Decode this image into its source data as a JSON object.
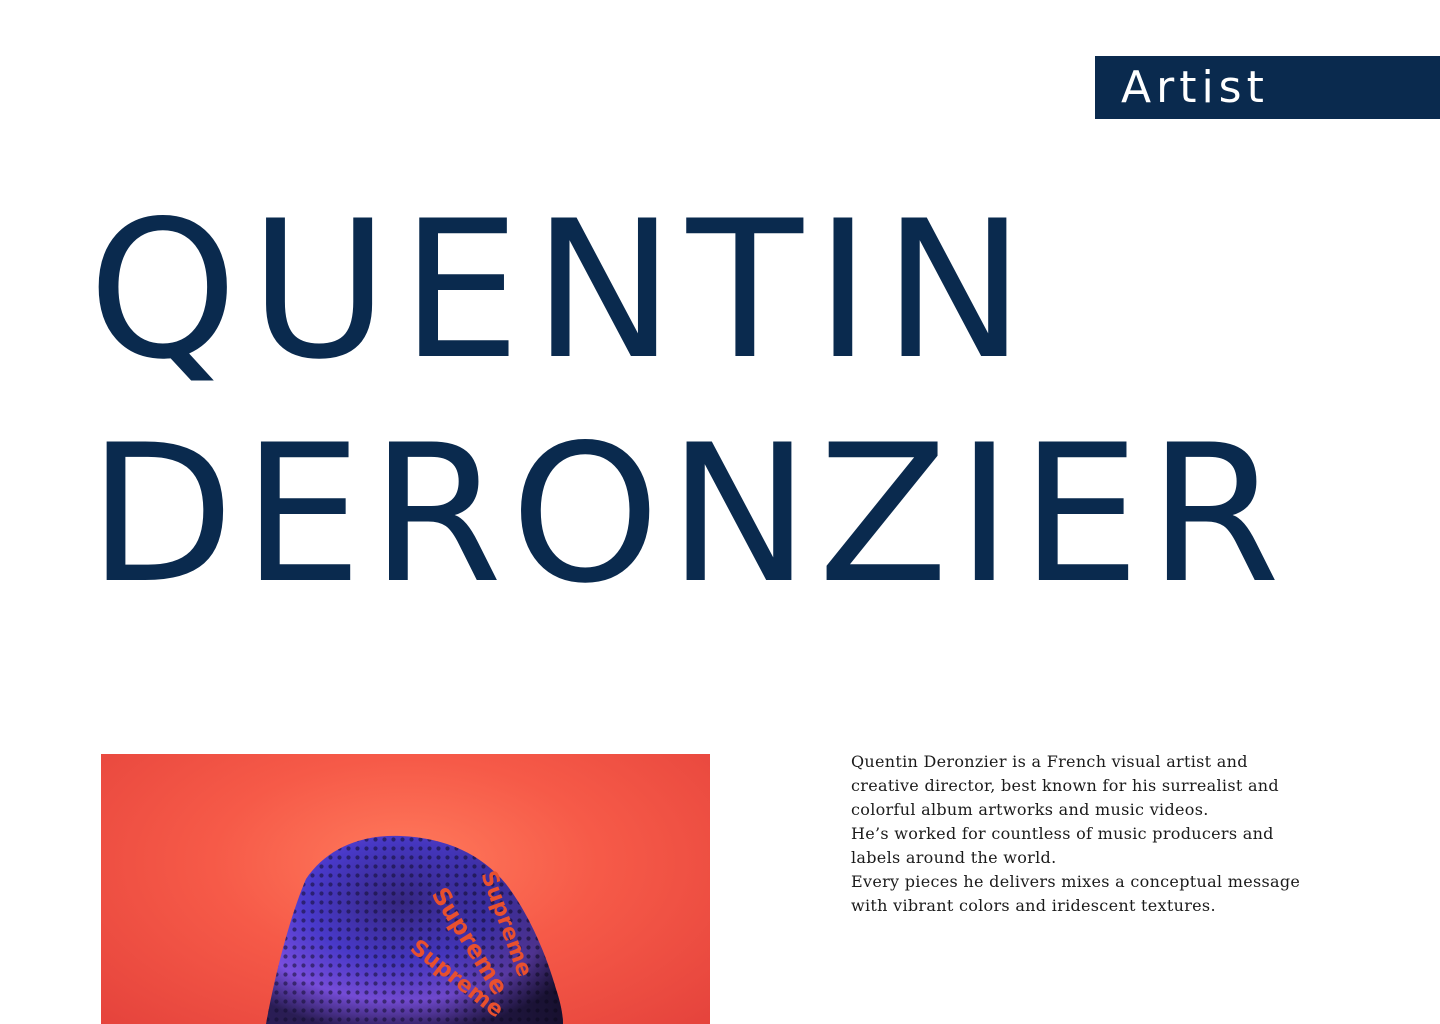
{
  "tag": {
    "label": "Artist"
  },
  "name": {
    "first": "QUENTIN",
    "last": "DERONZIER"
  },
  "photo": {
    "graphic_text": "Supreme"
  },
  "bio": {
    "paragraphs": [
      "Quentin Deronzier is a French visual artist and creative director, best known for his surrealist and colorful album artworks and music videos.",
      "He’s worked for countless of music producers and labels around the world.",
      "Every pieces he delivers mixes a conceptual message with vibrant colors and iridescent textures."
    ]
  },
  "colors": {
    "navy": "#0a2a4e",
    "background": "#ffffff",
    "photo_red": "#f65a48"
  }
}
